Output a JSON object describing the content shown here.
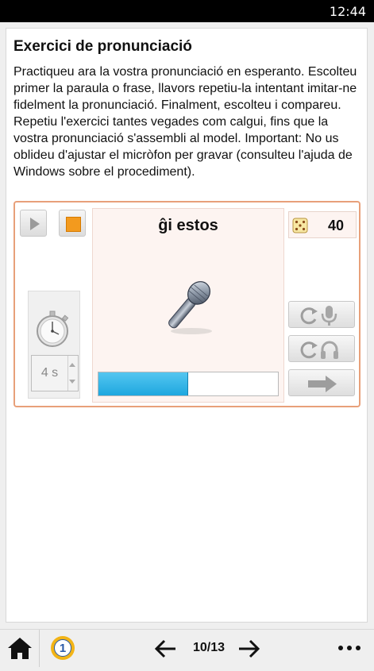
{
  "status_bar": {
    "time": "12:44"
  },
  "exercise": {
    "title": "Exercici de pronunciació",
    "instructions": "Practiqueu ara la vostra pronunciació en esperanto. Escolteu primer la paraula o frase, llavors repetiu-la intentant imitar-ne fidelment la pronunciació. Finalment, escolteu i compareu. Repetiu l'exercici tantes vegades com calgui, fins que la vostra pronunciació s'assembli al model. Important: No us oblideu d'ajustar el micròfon per gravar (consulteu l'ajuda de Windows sobre el procediment)."
  },
  "player": {
    "word": "ĝi estos",
    "delay_value": "4 s",
    "score": "40",
    "progress_fraction": 0.5
  },
  "icons": {
    "play": "play-icon",
    "stop": "stop-icon",
    "timer": "stopwatch-icon",
    "microphone": "microphone-icon",
    "dice": "dice-icon",
    "record": "repeat-microphone-icon",
    "listen": "repeat-headphones-icon",
    "next": "arrow-right-icon"
  },
  "bottom_bar": {
    "page": "10/13",
    "level_badge": "1"
  },
  "colors": {
    "accent_border": "#e8a07a",
    "stop": "#f39a1e",
    "progress": "#29abe2",
    "badge": "#f2b417"
  }
}
